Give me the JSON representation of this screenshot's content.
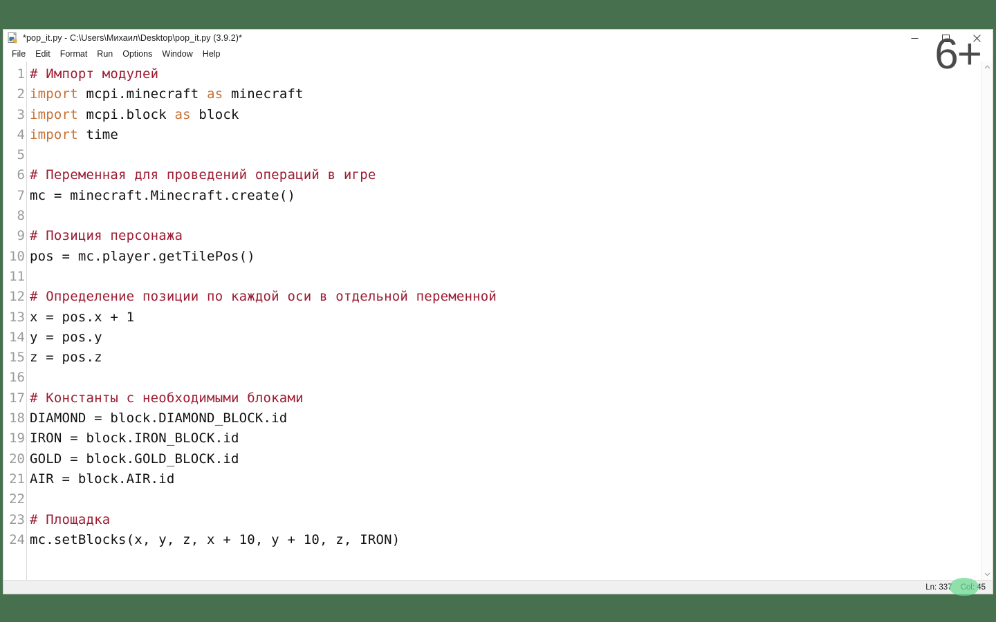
{
  "desktop": {
    "background_color": "#47704e"
  },
  "window": {
    "title": "*pop_it.py - C:\\Users\\Михаил\\Desktop\\pop_it.py (3.9.2)*",
    "app_icon": "python-idle-icon",
    "controls": {
      "minimize": "Minimize",
      "restore": "Restore",
      "close": "Close"
    }
  },
  "menubar": {
    "items": [
      {
        "label": "File"
      },
      {
        "label": "Edit"
      },
      {
        "label": "Format"
      },
      {
        "label": "Run"
      },
      {
        "label": "Options"
      },
      {
        "label": "Window"
      },
      {
        "label": "Help"
      }
    ]
  },
  "editor": {
    "colors": {
      "comment": "#9c1c32",
      "keyword": "#c87137",
      "plain": "#111111",
      "line_number": "#9a9a9a"
    },
    "line_numbers": [
      "1",
      "2",
      "3",
      "4",
      "5",
      "6",
      "7",
      "8",
      "9",
      "10",
      "11",
      "12",
      "13",
      "14",
      "15",
      "16",
      "17",
      "18",
      "19",
      "20",
      "21",
      "22",
      "23",
      "24"
    ],
    "lines": [
      {
        "n": "1",
        "tokens": [
          {
            "t": "comment",
            "s": "# Импорт модулей"
          }
        ]
      },
      {
        "n": "2",
        "tokens": [
          {
            "t": "kw",
            "s": "import"
          },
          {
            "t": "plain",
            "s": " mcpi.minecraft "
          },
          {
            "t": "kw",
            "s": "as"
          },
          {
            "t": "plain",
            "s": " minecraft"
          }
        ]
      },
      {
        "n": "3",
        "tokens": [
          {
            "t": "kw",
            "s": "import"
          },
          {
            "t": "plain",
            "s": " mcpi.block "
          },
          {
            "t": "kw",
            "s": "as"
          },
          {
            "t": "plain",
            "s": " block"
          }
        ]
      },
      {
        "n": "4",
        "tokens": [
          {
            "t": "kw",
            "s": "import"
          },
          {
            "t": "plain",
            "s": " time"
          }
        ]
      },
      {
        "n": "5",
        "tokens": [
          {
            "t": "plain",
            "s": ""
          }
        ]
      },
      {
        "n": "6",
        "tokens": [
          {
            "t": "comment",
            "s": "# Переменная для проведений операций в игре"
          }
        ]
      },
      {
        "n": "7",
        "tokens": [
          {
            "t": "plain",
            "s": "mc = minecraft.Minecraft.create()"
          }
        ]
      },
      {
        "n": "8",
        "tokens": [
          {
            "t": "plain",
            "s": ""
          }
        ]
      },
      {
        "n": "9",
        "tokens": [
          {
            "t": "comment",
            "s": "# Позиция персонажа"
          }
        ]
      },
      {
        "n": "10",
        "tokens": [
          {
            "t": "plain",
            "s": "pos = mc.player.getTilePos()"
          }
        ]
      },
      {
        "n": "11",
        "tokens": [
          {
            "t": "plain",
            "s": ""
          }
        ]
      },
      {
        "n": "12",
        "tokens": [
          {
            "t": "comment",
            "s": "# Определение позиции по каждой оси в отдельной переменной"
          }
        ]
      },
      {
        "n": "13",
        "tokens": [
          {
            "t": "plain",
            "s": "x = pos.x + 1"
          }
        ]
      },
      {
        "n": "14",
        "tokens": [
          {
            "t": "plain",
            "s": "y = pos.y"
          }
        ]
      },
      {
        "n": "15",
        "tokens": [
          {
            "t": "plain",
            "s": "z = pos.z"
          }
        ]
      },
      {
        "n": "16",
        "tokens": [
          {
            "t": "plain",
            "s": ""
          }
        ]
      },
      {
        "n": "17",
        "tokens": [
          {
            "t": "comment",
            "s": "# Константы с необходимыми блоками"
          }
        ]
      },
      {
        "n": "18",
        "tokens": [
          {
            "t": "plain",
            "s": "DIAMOND = block.DIAMOND_BLOCK.id"
          }
        ]
      },
      {
        "n": "19",
        "tokens": [
          {
            "t": "plain",
            "s": "IRON = block.IRON_BLOCK.id"
          }
        ]
      },
      {
        "n": "20",
        "tokens": [
          {
            "t": "plain",
            "s": "GOLD = block.GOLD_BLOCK.id"
          }
        ]
      },
      {
        "n": "21",
        "tokens": [
          {
            "t": "plain",
            "s": "AIR = block.AIR.id"
          }
        ]
      },
      {
        "n": "22",
        "tokens": [
          {
            "t": "plain",
            "s": ""
          }
        ]
      },
      {
        "n": "23",
        "tokens": [
          {
            "t": "comment",
            "s": "# Площадка"
          }
        ]
      },
      {
        "n": "24",
        "tokens": [
          {
            "t": "plain",
            "s": "mc.setBlocks(x, y, z, x + 10, y + 10, z, IRON)"
          }
        ]
      }
    ]
  },
  "scrollbar": {
    "up_arrow": "chevron-up-icon",
    "down_arrow": "chevron-down-icon"
  },
  "statusbar": {
    "line_label": "Ln: 337",
    "col_label": "Col: 45"
  },
  "overlays": {
    "age_rating": "6+",
    "age_rating_color": "#4a4a4a",
    "cursor_highlight_color": "#69d98f"
  }
}
